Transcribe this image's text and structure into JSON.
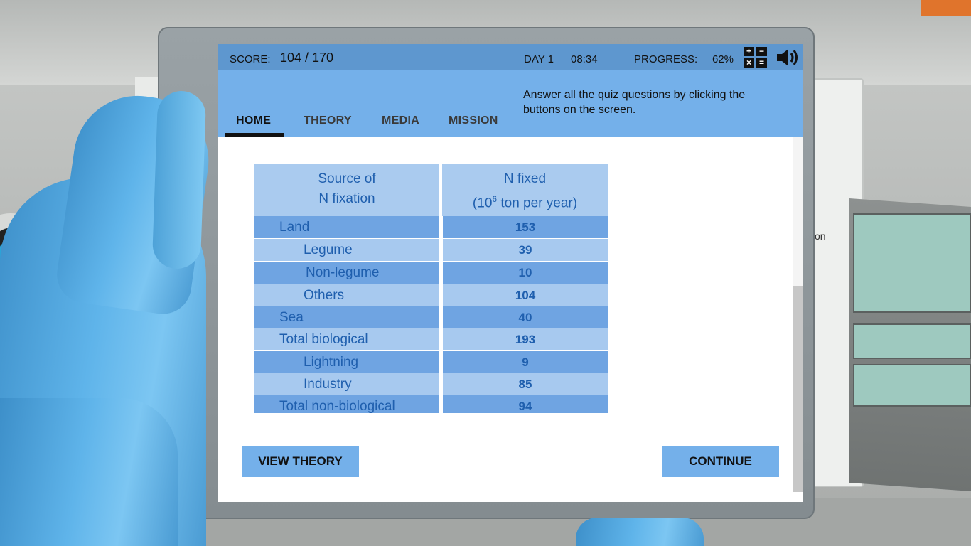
{
  "header": {
    "score_label": "SCORE:",
    "score_value": "104 / 170",
    "day_label": "DAY 1",
    "time": "08:34",
    "progress_label": "PROGRESS:",
    "progress_value": "62%",
    "calculator_icon": "calculator-icon",
    "calculator_glyphs": [
      "+",
      "−",
      "×",
      "="
    ],
    "sound_icon": "speaker-icon"
  },
  "nav": {
    "tabs": [
      {
        "label": "HOME",
        "active": true
      },
      {
        "label": "THEORY",
        "active": false
      },
      {
        "label": "MEDIA",
        "active": false
      },
      {
        "label": "MISSION",
        "active": false
      }
    ],
    "instruction": "Answer all the quiz questions by clicking the buttons on the screen."
  },
  "table": {
    "header_left_line1": "Source of",
    "header_left_line2": "N fixation",
    "header_right_line1": "N fixed",
    "header_right_line2_pre": "(10",
    "header_right_line2_sup": "6",
    "header_right_line2_post": " ton per year)",
    "rows": [
      {
        "label": "Land",
        "value": "153"
      },
      {
        "label": "Legume",
        "value": "39"
      },
      {
        "label": "Non-legume",
        "value": "10"
      },
      {
        "label": "Others",
        "value": "104"
      },
      {
        "label": "Sea",
        "value": "40"
      },
      {
        "label": "Total biological",
        "value": "193"
      },
      {
        "label": "Lightning",
        "value": "9"
      },
      {
        "label": "Industry",
        "value": "85"
      },
      {
        "label": "Total non-biological",
        "value": "94"
      }
    ]
  },
  "buttons": {
    "view_theory": "VIEW THEORY",
    "continue": "CONTINUE"
  },
  "background": {
    "side_panel_text": "on"
  },
  "colors": {
    "topbar": "#5e97cf",
    "navbar": "#74b0ea",
    "table_dark_row": "#6fa4e2",
    "table_light_row": "#a7c9ef",
    "table_text": "#1f5fae",
    "glove": "#5fb4ea"
  }
}
